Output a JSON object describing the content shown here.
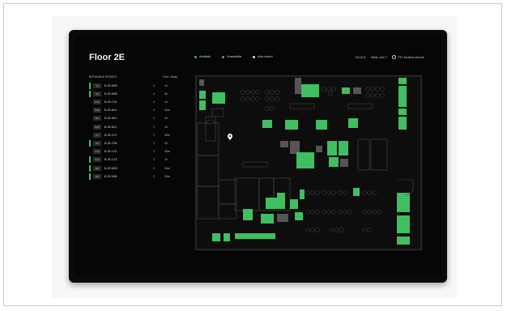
{
  "floor_title": "Floor 2E",
  "legend": [
    {
      "label": "Available",
      "color": "#3fbf5f"
    },
    {
      "label": "Unavailable",
      "color": "#8a8a8a"
    },
    {
      "label": "Auto-cancel",
      "color": "#d9d9d9"
    }
  ],
  "header": {
    "time": "13:02 A",
    "date": "Wed, Jan 7",
    "location": "737 broken clouds"
  },
  "list_header": {
    "title": "BOOKABLE SPACES",
    "right": "Free / Busy"
  },
  "rooms": [
    {
      "cap": "10",
      "name": "B-2E-M03",
      "people": "2",
      "avail": "1h",
      "status": "available"
    },
    {
      "cap": "10",
      "name": "B-2E-M50",
      "people": "2",
      "avail": "3h",
      "status": "available"
    },
    {
      "cap": "C10",
      "name": "B-2E-C10",
      "people": "2",
      "avail": "1h",
      "status": "none"
    },
    {
      "cap": "B12",
      "name": "B-2E-B14",
      "people": "2",
      "avail": "30m",
      "status": "none"
    },
    {
      "cap": "E3",
      "name": "B-2E-A01",
      "people": "2",
      "avail": "1h",
      "status": "none"
    },
    {
      "cap": "B12",
      "name": "B-2E-B12",
      "people": "2",
      "avail": "1h",
      "status": "none"
    },
    {
      "cap": "C7",
      "name": "B-2E-C07",
      "people": "2",
      "avail": "30m",
      "status": "none"
    },
    {
      "cap": "C8",
      "name": "B-2E-C08",
      "people": "2",
      "avail": "3h",
      "status": "available"
    },
    {
      "cap": "C12",
      "name": "B-2E-C12",
      "people": "2",
      "avail": "30m",
      "status": "none"
    },
    {
      "cap": "C13",
      "name": "B-2E-C13",
      "people": "2",
      "avail": "1h",
      "status": "available"
    },
    {
      "cap": "M3",
      "name": "B-2E-M03",
      "people": "2",
      "avail": "30m",
      "status": "available"
    },
    {
      "cap": "M6",
      "name": "B-2E-N06",
      "people": "2",
      "avail": "30m",
      "status": "available"
    }
  ],
  "colors": {
    "available": "#3fbf5f",
    "available_dark": "#2f8f49",
    "unavailable": "#555555",
    "wall": "#6b6b6b",
    "background": "#060606"
  },
  "map": {
    "pin_icon": "location-pin-icon"
  }
}
